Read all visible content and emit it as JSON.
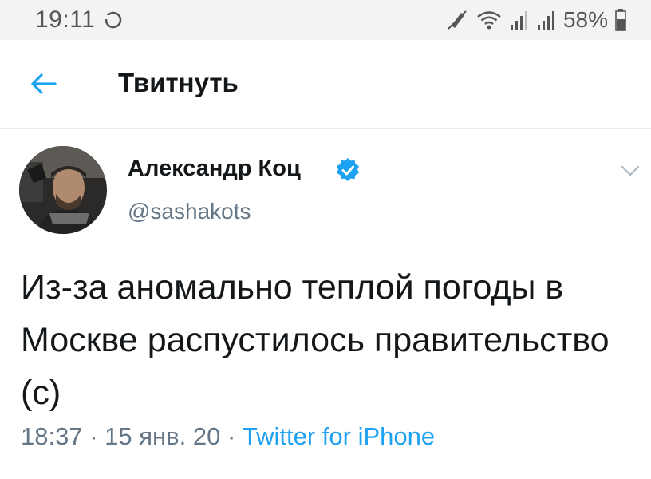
{
  "status_bar": {
    "time": "19:11",
    "battery": "58%",
    "icons": [
      "sync-icon",
      "no-sim-icon",
      "wifi-icon",
      "signal-icon",
      "signal-icon",
      "battery-icon"
    ]
  },
  "header": {
    "back_icon": "arrow-left-icon",
    "title": "Твитнуть"
  },
  "tweet": {
    "author_name": "Александр Коц",
    "verified_icon": "verified-badge-icon",
    "handle": "@sashakots",
    "text": "Из-за аномально теплой погоды в Москве распустилось правительство (с)",
    "time": "18:37",
    "date": "15 янв. 20",
    "source": "Twitter for iPhone",
    "separator": " · "
  },
  "colors": {
    "accent": "#1da1f2",
    "text_primary": "#14171a",
    "text_secondary": "#657786",
    "status_bar_bg": "#f3f3f3"
  }
}
